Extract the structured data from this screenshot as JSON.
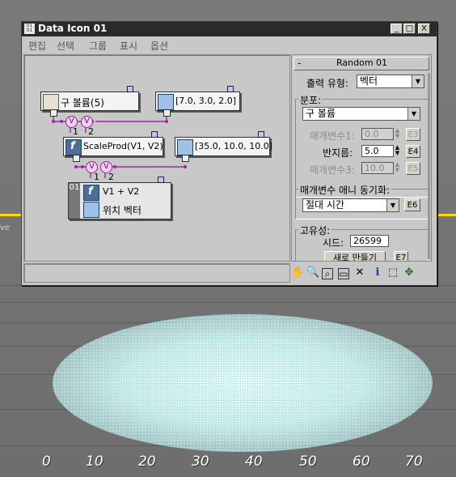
{
  "window": {
    "title": "Data Icon 01",
    "icon_text": "01 01",
    "buttons": {
      "minimize": "_",
      "maximize": "□",
      "close": "X"
    }
  },
  "menu": [
    "편집",
    "선택",
    "그룹",
    "표시",
    "옵션"
  ],
  "nodes": {
    "volume": {
      "label": "구 볼륨(5)"
    },
    "vec1": {
      "label": "[7.0, 3.0, 2.0]"
    },
    "scaleprod": {
      "label": "ScaleProd(V1, V2)"
    },
    "vec2": {
      "label": "[35.0, 10.0, 10.0]"
    },
    "sum": {
      "badge": "01",
      "label": "V1 + V2",
      "sublabel": "위치 벡터"
    },
    "v_label": "V",
    "pin1": "1",
    "pin2": "2"
  },
  "panel": {
    "header": "Random 01",
    "collapse": "-",
    "output_type_label": "출력 유형:",
    "output_type_value": "벡터",
    "distribution_label": "분포:",
    "distribution_value": "구 볼륨",
    "param1_label": "매개변수1:",
    "param1_value": "0.0",
    "param1_btn": "E3",
    "radius_label": "반지름:",
    "radius_value": "5.0",
    "radius_btn": "E4",
    "param3_label": "매개변수3:",
    "param3_value": "10.0",
    "param3_btn": "E5",
    "anim_sync_label": "매개변수 애니 동기화:",
    "anim_sync_value": "절대 시간",
    "anim_sync_btn": "E6",
    "uniqueness_label": "고유성:",
    "seed_label": "시드:",
    "seed_value": "26599",
    "new_button": "새로 만들기",
    "new_btn_code": "E7"
  },
  "toolbar": [
    "hand-icon",
    "zoom-icon",
    "zoom-region-icon",
    "zoom-extents-icon",
    "delete-icon",
    "info-icon",
    "select-icon",
    "move-icon"
  ],
  "ruler": {
    "ticks": [
      "0",
      "10",
      "20",
      "30",
      "40",
      "50",
      "60",
      "70"
    ]
  },
  "viewport_label": "ve",
  "colors": {
    "titlebar": "#2a2a2a",
    "wire": "#9a2a9a",
    "node_icon": "#4a6f9a",
    "particles": "#bff3f3"
  }
}
